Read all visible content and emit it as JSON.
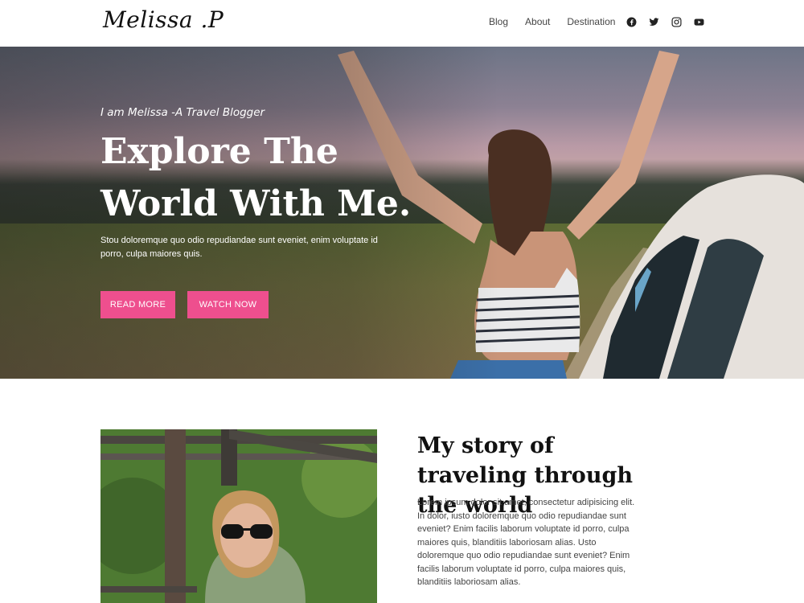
{
  "header": {
    "logo": "Melissa .P",
    "nav": [
      "Blog",
      "About",
      "Destination"
    ],
    "social_icons": [
      "facebook-icon",
      "twitter-icon",
      "instagram-icon",
      "youtube-icon"
    ]
  },
  "hero": {
    "tagline": "I am Melissa -A Travel Blogger",
    "headline_line1": "Explore The",
    "headline_line2": "World With Me.",
    "description": "Stou doloremque quo odio repudiandae sunt eveniet, enim voluptate id porro, culpa maiores quis.",
    "read_more": "READ MORE",
    "watch_now": "WATCH NOW"
  },
  "story": {
    "title": "My story of traveling through the world",
    "body": "Lorem ipsum dolor sit amet, consectetur adipisicing elit. In dolor, iusto doloremque quo odio repudiandae sunt eveniet? Enim facilis laborum voluptate id porro, culpa maiores quis, blanditiis laboriosam alias. Usto doloremque quo odio repudiandae sunt eveniet? Enim facilis laborum voluptate id porro, culpa maiores quis, blanditiis laboriosam alias."
  },
  "colors": {
    "accent": "#ee4f8e",
    "text_dark": "#111111"
  }
}
